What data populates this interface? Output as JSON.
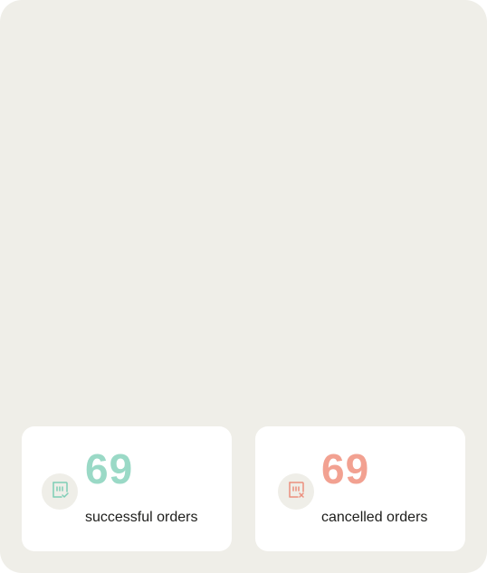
{
  "stats": {
    "successful": {
      "count": "69",
      "label": "successful orders",
      "icon": "receipt-check-icon",
      "color": "#9ad9c6"
    },
    "cancelled": {
      "count": "69",
      "label": "cancelled orders",
      "icon": "receipt-x-icon",
      "color": "#f2a191"
    }
  }
}
